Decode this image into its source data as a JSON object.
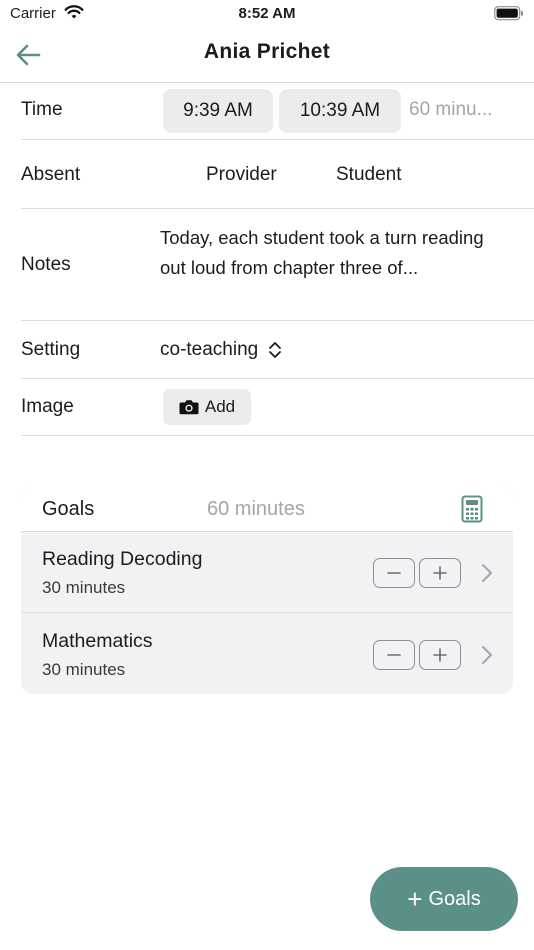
{
  "status_bar": {
    "carrier": "Carrier",
    "time": "8:52 AM"
  },
  "nav": {
    "title": "Ania Prichet"
  },
  "form": {
    "time": {
      "label": "Time",
      "start": "9:39 AM",
      "end": "10:39 AM",
      "duration": "60 minu..."
    },
    "absent": {
      "label": "Absent",
      "options": [
        "Provider",
        "Student"
      ]
    },
    "notes": {
      "label": "Notes",
      "value": "Today, each student took a turn reading out loud from chapter three of..."
    },
    "setting": {
      "label": "Setting",
      "value": "co-teaching"
    },
    "image": {
      "label": "Image",
      "add_label": "Add"
    }
  },
  "goals": {
    "title": "Goals",
    "total": "60 minutes",
    "items": [
      {
        "name": "Reading Decoding",
        "minutes": "30 minutes"
      },
      {
        "name": "Mathematics",
        "minutes": "30 minutes"
      }
    ]
  },
  "fab": {
    "label": "Goals"
  },
  "colors": {
    "accent": "#5a9088",
    "muted": "#a5a5aa",
    "pill": "#ececee",
    "card": "#f2f2f5"
  },
  "icons": [
    "wifi-icon",
    "battery-icon",
    "back-arrow-icon",
    "chevron-updown-icon",
    "camera-icon",
    "calculator-icon",
    "minus-icon",
    "plus-icon",
    "chevron-right-icon"
  ]
}
